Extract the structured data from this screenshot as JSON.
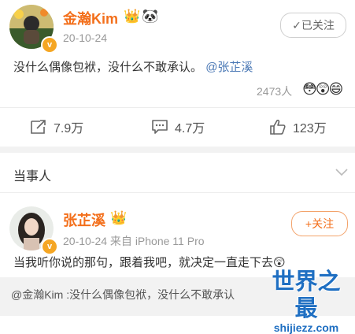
{
  "post1": {
    "author": "金瀚Kim",
    "date": "20-10-24",
    "follow_label": "✓已关注",
    "text": "没什么偶像包袱，没什么不敢承认。",
    "mention": "@张芷溪",
    "likes_count": "2473人",
    "reactions": [
      "😳",
      "😲",
      "😄"
    ],
    "actions": {
      "repost": "7.9万",
      "comment": "4.7万",
      "like": "123万"
    },
    "icons": [
      "crown-emoji-icon",
      "panda-emoji-icon",
      "verified-badge-icon"
    ]
  },
  "section_title": "当事人",
  "post2": {
    "author": "张芷溪",
    "date_source": "20-10-24  来自 iPhone 11 Pro",
    "follow_label": "+关注",
    "text": "当我听你说的那句，跟着我吧，就决定一直走下去😲",
    "quoted": "@金瀚Kim :没什么偶像包袱，没什么不敢承认"
  },
  "watermark": {
    "title": "世界之最",
    "url": "shijiezz.com"
  },
  "colors": {
    "name": "#f36f1b",
    "mention": "#4a78b5",
    "badge": "#f5a623",
    "watermark": "#1f6fc2"
  }
}
